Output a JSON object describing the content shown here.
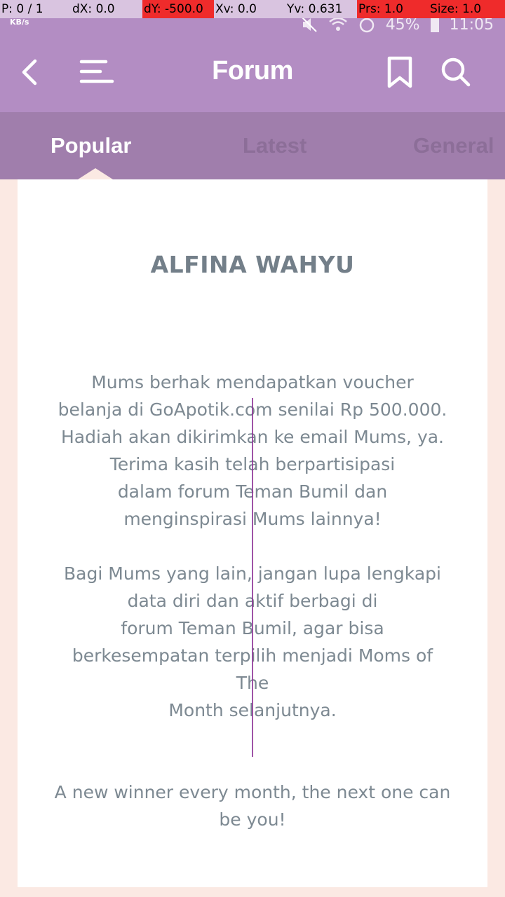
{
  "debug": {
    "cells": [
      {
        "text": "P: 0 / 1",
        "alert": false
      },
      {
        "text": "dX: 0.0",
        "alert": false
      },
      {
        "text": "dY: -500.0",
        "alert": true
      },
      {
        "text": "Xv: 0.0",
        "alert": false
      },
      {
        "text": "Yv: 0.631",
        "alert": false
      },
      {
        "text": "Prs: 1.0",
        "alert": true
      },
      {
        "text": "Size: 1.0",
        "alert": true
      }
    ]
  },
  "status_bar": {
    "speed_unit": "KB/s",
    "battery": "45%",
    "time": "11:05"
  },
  "app_bar": {
    "title": "Forum",
    "icons": {
      "back": "back-arrow-icon",
      "menu": "hamburger-menu-icon",
      "bookmark": "bookmark-icon",
      "search": "search-icon"
    }
  },
  "tabs": [
    {
      "label": "Popular",
      "active": true
    },
    {
      "label": "Latest",
      "active": false
    },
    {
      "label": "General",
      "active": false
    }
  ],
  "content": {
    "winner_name": "ALFINA WAHYU",
    "paragraph1": [
      "Mums berhak mendapatkan voucher",
      "belanja di GoApotik.com senilai Rp 500.000.",
      "Hadiah akan dikirimkan ke email Mums, ya.",
      "Terima kasih telah berpartisipasi",
      "dalam forum Teman Bumil dan",
      "menginspirasi Mums lainnya!"
    ],
    "paragraph2": [
      "Bagi Mums yang lain, jangan lupa lengkapi",
      "data diri dan aktif berbagi di",
      "forum Teman Bumil, agar bisa",
      "berkesempatan terpilih menjadi Moms of",
      "The",
      "Month selanjutnya."
    ],
    "paragraph3": [
      "A new winner every month, the next one can",
      "be you!"
    ]
  },
  "colors": {
    "app_bar": "#b38dc3",
    "tab_bar": "#a07eac",
    "page_background": "#fbe9e3",
    "text": "#7d8992"
  }
}
